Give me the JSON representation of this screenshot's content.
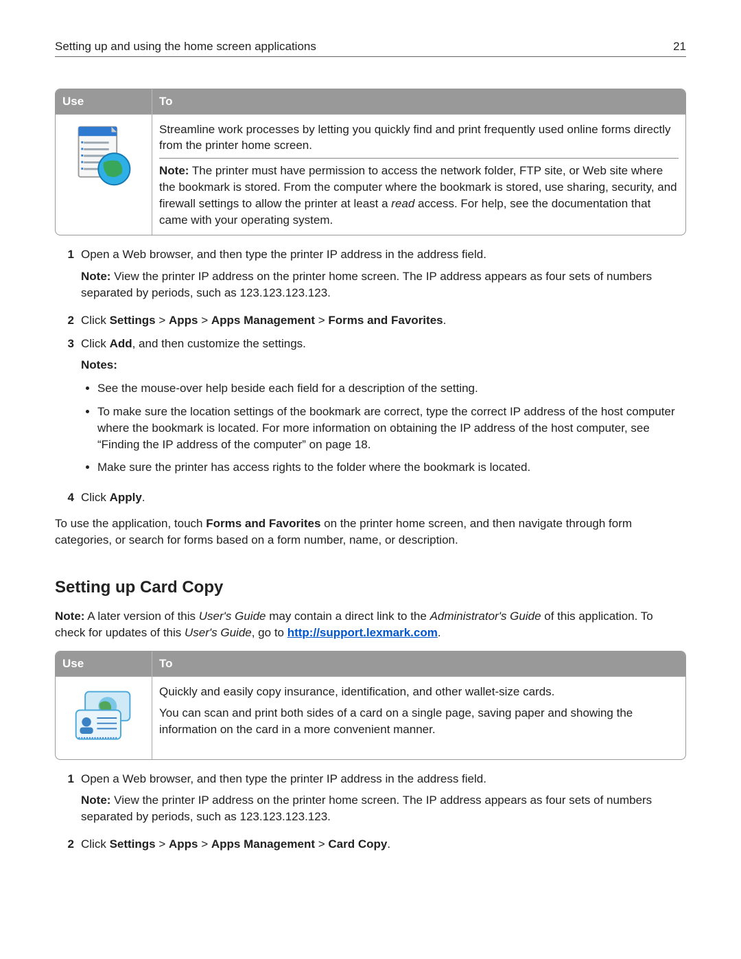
{
  "header": {
    "title": "Setting up and using the home screen applications",
    "page_number": "21"
  },
  "table1": {
    "col_use": "Use",
    "col_to": "To",
    "to_line1": "Streamline work processes by letting you quickly find and print frequently used online forms directly from the printer home screen.",
    "note_label": "Note:",
    "note_text": " The printer must have permission to access the network folder, FTP site, or Web site where the bookmark is stored. From the computer where the bookmark is stored, use sharing, security, and firewall settings to allow the printer at least a ",
    "note_read": "read",
    "note_text2": " access. For help, see the documentation that came with your operating system."
  },
  "steps1": {
    "s1": "Open a Web browser, and then type the printer IP address in the address field.",
    "s1_note_label": "Note:",
    "s1_note": " View the printer IP address on the printer home screen. The IP address appears as four sets of numbers separated by periods, such as 123.123.123.123.",
    "s2_pre": "Click ",
    "s2_b1": "Settings",
    "s2_gt": " > ",
    "s2_b2": "Apps",
    "s2_b3": "Apps Management",
    "s2_b4": "Forms and Favorites",
    "s2_post": ".",
    "s3_pre": "Click ",
    "s3_b": "Add",
    "s3_post": ", and then customize the settings.",
    "notes_head": "Notes:",
    "bullet1": "See the mouse-over help beside each field for a description of the setting.",
    "bullet2": "To make sure the location settings of the bookmark are correct, type the correct IP address of the host computer where the bookmark is located. For more information on obtaining the IP address of the host computer, see “Finding the IP address of the computer” on page 18.",
    "bullet3": "Make sure the printer has access rights to the folder where the bookmark is located.",
    "s4_pre": "Click ",
    "s4_b": "Apply",
    "s4_post": "."
  },
  "post1_pre": "To use the application, touch ",
  "post1_b": "Forms and Favorites",
  "post1_post": " on the printer home screen, and then navigate through form categories, or search for forms based on a form number, name, or description.",
  "section2": {
    "title": "Setting up Card Copy",
    "note_label": "Note:",
    "note_pre": " A later version of this ",
    "note_i1": "User's Guide",
    "note_mid": " may contain a direct link to the ",
    "note_i2": "Administrator's Guide",
    "note_mid2": " of this application. To check for updates of this ",
    "note_i3": "User's Guide",
    "note_post": ", go to ",
    "link_text": "http://support.lexmark.com",
    "note_end": "."
  },
  "table2": {
    "col_use": "Use",
    "col_to": "To",
    "p1": "Quickly and easily copy insurance, identification, and other wallet-size cards.",
    "p2": "You can scan and print both sides of a card on a single page, saving paper and showing the information on the card in a more convenient manner."
  },
  "steps2": {
    "s1": "Open a Web browser, and then type the printer IP address in the address field.",
    "s1_note_label": "Note:",
    "s1_note": " View the printer IP address on the printer home screen. The IP address appears as four sets of numbers separated by periods, such as 123.123.123.123.",
    "s2_pre": "Click ",
    "s2_b1": "Settings",
    "s2_gt": " > ",
    "s2_b2": "Apps",
    "s2_b3": "Apps Management",
    "s2_b4": "Card Copy",
    "s2_post": "."
  }
}
